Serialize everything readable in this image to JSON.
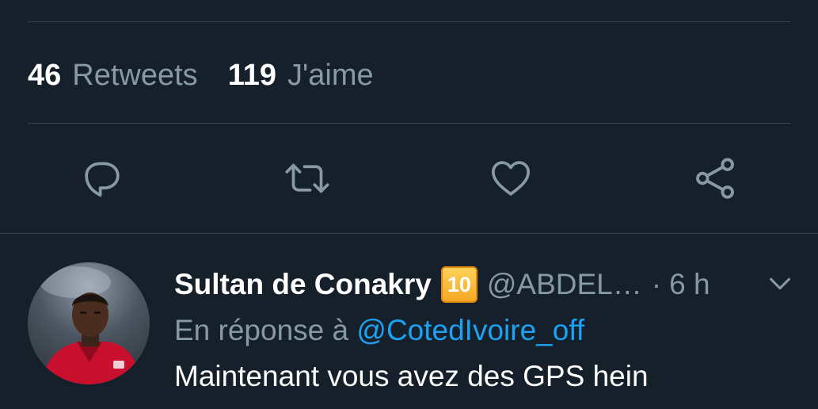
{
  "stats": {
    "retweets": {
      "count": "46",
      "label": "Retweets"
    },
    "likes": {
      "count": "119",
      "label": "J'aime"
    }
  },
  "actions": {
    "reply_icon": "reply-icon",
    "retweet_icon": "retweet-icon",
    "like_icon": "heart-icon",
    "share_icon": "share-icon"
  },
  "reply": {
    "display_name": "Sultan de Conakry",
    "badge": "10",
    "handle": "@ABDEL…",
    "separator": "·",
    "time": "6 h",
    "reply_prefix": "En réponse à",
    "reply_mention": "@CotedIvoire_off",
    "text": "Maintenant vous avez des GPS hein"
  },
  "colors": {
    "background": "#15202b",
    "divider": "#38444d",
    "secondary_text": "#8899a6",
    "link": "#1da1f2",
    "icon": "#8899a6"
  }
}
